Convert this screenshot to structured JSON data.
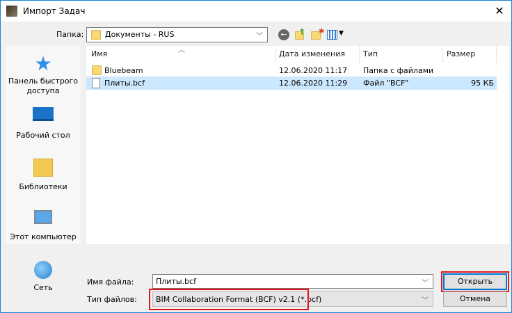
{
  "window": {
    "title": "Импорт Задач",
    "close": "✕"
  },
  "toolbar": {
    "folder_label": "Папка:",
    "folder_value": "Документы - RUS"
  },
  "sidebar": {
    "items": [
      {
        "label": "Панель быстрого доступа"
      },
      {
        "label": "Рабочий стол"
      },
      {
        "label": "Библиотеки"
      },
      {
        "label": "Этот компьютер"
      },
      {
        "label": "Сеть"
      }
    ]
  },
  "list": {
    "columns": [
      "Имя",
      "Дата изменения",
      "Тип",
      "Размер"
    ],
    "rows": [
      {
        "name": "Bluebeam",
        "date": "12.06.2020 11:17",
        "type": "Папка с файлами",
        "size": ""
      },
      {
        "name": "Плиты.bcf",
        "date": "12.06.2020 11:29",
        "type": "Файл \"BCF\"",
        "size": "95 КБ"
      }
    ]
  },
  "bottom": {
    "filename_label": "Имя файла:",
    "filename_value": "Плиты.bcf",
    "filetype_label": "Тип файлов:",
    "filetype_value": "BIM Collaboration Format (BCF) v2.1  (*.bcf)",
    "open": "Открыть",
    "cancel": "Отмена"
  },
  "colors": {
    "accent": "#1883d7",
    "highlight": "#e0161d",
    "selection": "#cce8ff"
  }
}
